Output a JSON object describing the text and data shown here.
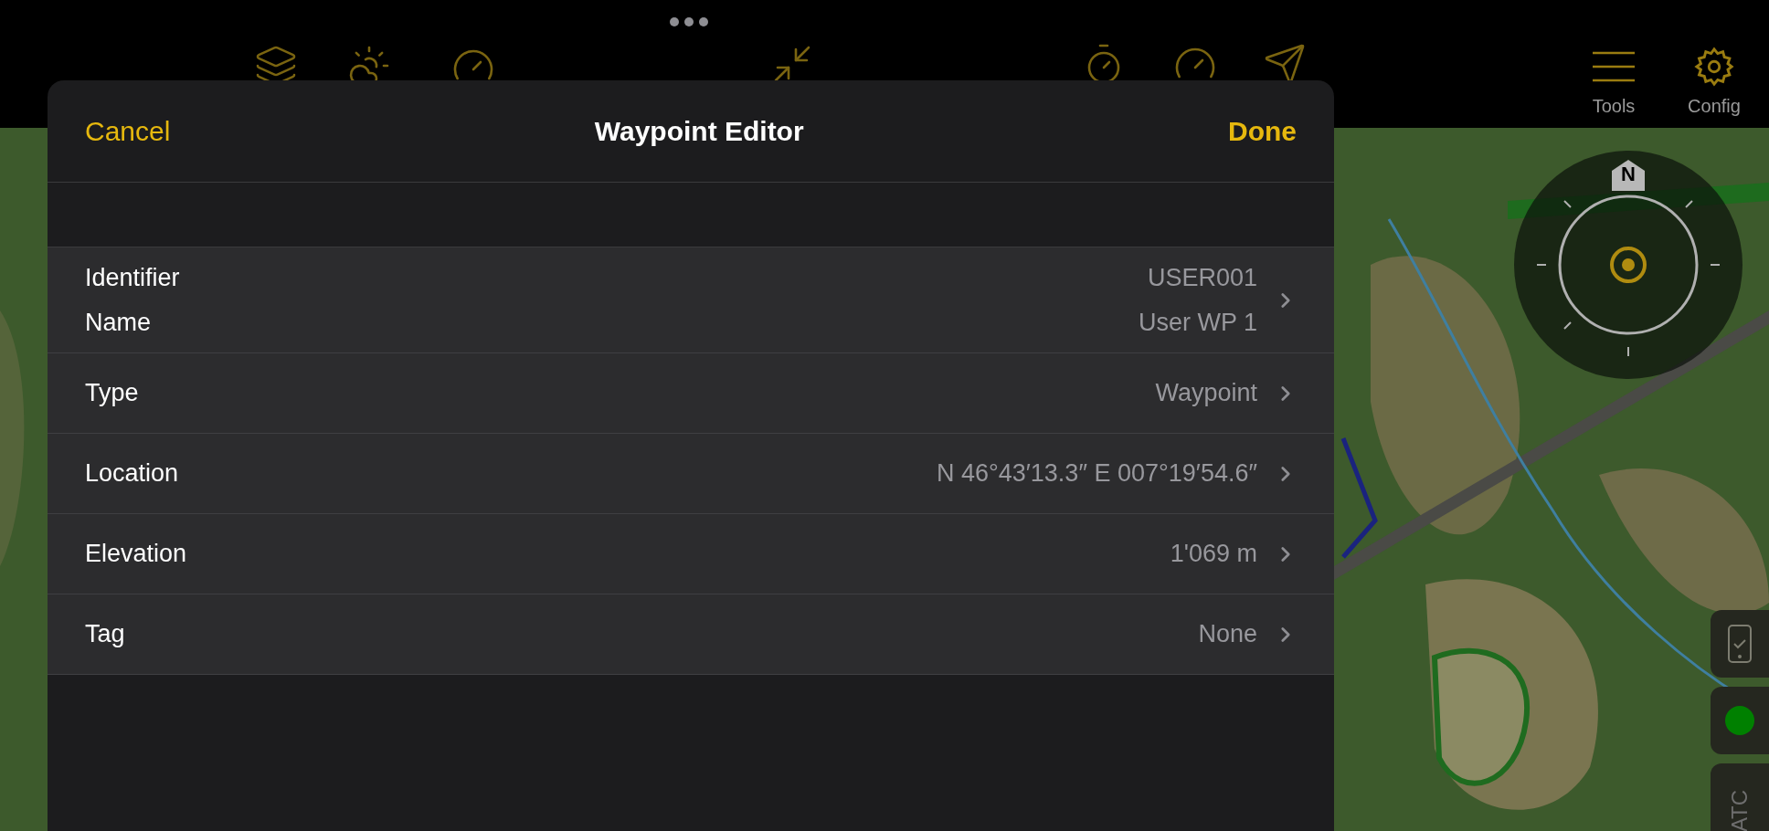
{
  "top_bar": {
    "tools": [
      {
        "kind": "menu",
        "label": "Tools"
      },
      {
        "kind": "gear",
        "label": "Config"
      }
    ]
  },
  "editor": {
    "cancel": "Cancel",
    "title": "Waypoint Editor",
    "done": "Done",
    "rows": [
      {
        "kind": "double",
        "labels": [
          "Identifier",
          "Name"
        ],
        "values": [
          "USER001",
          "User WP 1"
        ]
      },
      {
        "kind": "single",
        "label": "Type",
        "value": "Waypoint"
      },
      {
        "kind": "single",
        "label": "Location",
        "value": "N 46°43′13.3″ E 007°19′54.6″"
      },
      {
        "kind": "single",
        "label": "Elevation",
        "value": "1'069 m"
      },
      {
        "kind": "single",
        "label": "Tag",
        "value": "None"
      }
    ]
  },
  "compass": {
    "north": "N"
  },
  "side_buttons": [
    {
      "kind": "device"
    },
    {
      "kind": "status",
      "color": "#008000"
    },
    {
      "kind": "text",
      "label": "ATC"
    }
  ]
}
